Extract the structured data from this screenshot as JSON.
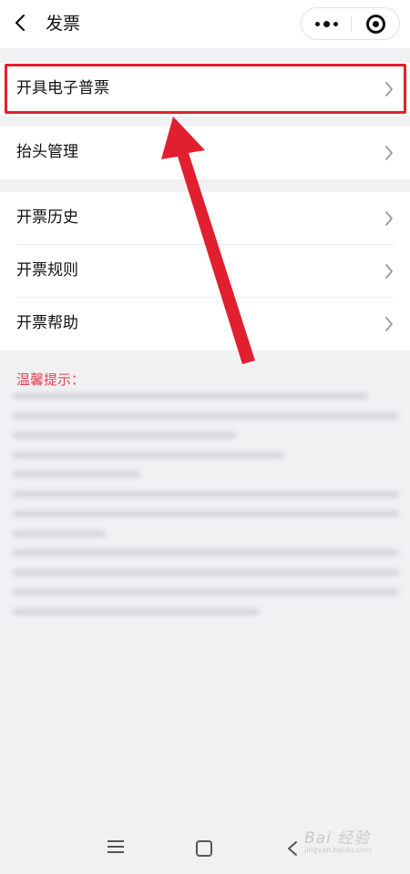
{
  "header": {
    "title": "发票",
    "back_icon": "chevron-left-icon",
    "more_icon": "more-dots-icon",
    "close_icon": "target-circle-icon"
  },
  "menu_groups": [
    {
      "items": [
        {
          "label": "开具电子普票"
        }
      ]
    },
    {
      "items": [
        {
          "label": "抬头管理"
        }
      ]
    },
    {
      "items": [
        {
          "label": "开票历史"
        },
        {
          "label": "开票规则"
        },
        {
          "label": "开票帮助"
        }
      ]
    }
  ],
  "tips": {
    "title": "温馨提示："
  },
  "annotation": {
    "highlight_color": "#e0202e"
  },
  "system_nav": {
    "menu_icon": "menu-lines-icon",
    "home_icon": "square-home-icon",
    "back_icon": "triangle-back-icon"
  },
  "watermark": {
    "text": "Bai 经验",
    "subtext": "jingyan.baidu.com"
  }
}
